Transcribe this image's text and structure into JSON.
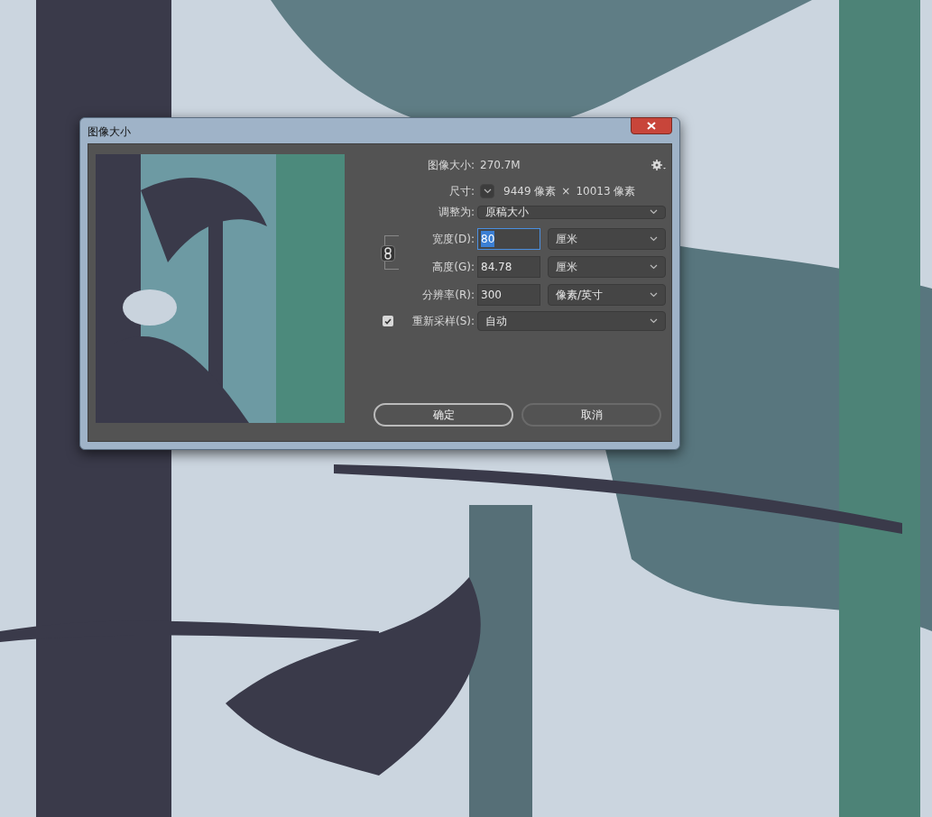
{
  "window": {
    "title": "图像大小"
  },
  "image_size": {
    "label": "图像大小:",
    "value": "270.7M"
  },
  "dimensions": {
    "label": "尺寸:",
    "width": "9449 像素",
    "times": "×",
    "height": "10013 像素"
  },
  "fit_to": {
    "label": "调整为:",
    "value": "原稿大小"
  },
  "constrain_proportions": {
    "on": true
  },
  "fields": [
    {
      "label": "宽度(D):",
      "value": "80",
      "unit": "厘米",
      "selected": true
    },
    {
      "label": "高度(G):",
      "value": "84.78",
      "unit": "厘米",
      "selected": false
    },
    {
      "label": "分辨率(R):",
      "value": "300",
      "unit": "像素/英寸",
      "selected": false
    }
  ],
  "resample": {
    "label": "重新采样(S):",
    "checked": true,
    "value": "自动"
  },
  "buttons": [
    {
      "label": "确定",
      "kind": "primary"
    },
    {
      "label": "取消",
      "kind": "secondary"
    }
  ]
}
